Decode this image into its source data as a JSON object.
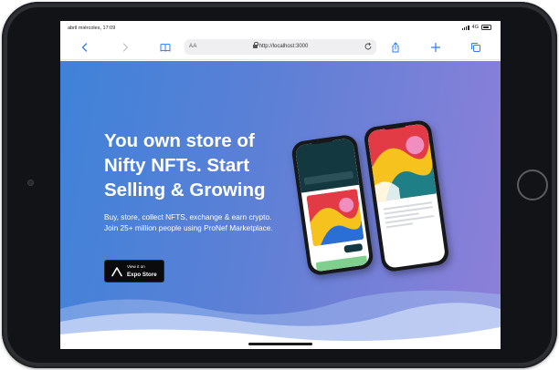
{
  "status_bar": {
    "time": "abril miércoles, 17:09",
    "network": "4G"
  },
  "browser": {
    "aa_label": "AA",
    "url": "http://localhost:3000",
    "icons": [
      "back-icon",
      "forward-icon",
      "bookmarks-icon",
      "lock-icon",
      "reload-icon",
      "share-icon",
      "new-tab-icon",
      "tabs-icon"
    ]
  },
  "hero": {
    "title": "You own store of Nifty NFTs. Start Selling & Growing",
    "description": "Buy, store, collect NFTS, exchange & earn crypto. Join 25+ million people using ProNef Marketplace.",
    "store_button": {
      "small": "View it on",
      "big": "Expo Store"
    }
  },
  "colors": {
    "hero_start": "#3f82d9",
    "hero_end": "#8f7fd8",
    "button_bg": "#0b0b0d",
    "app_dark": "#13383f"
  }
}
